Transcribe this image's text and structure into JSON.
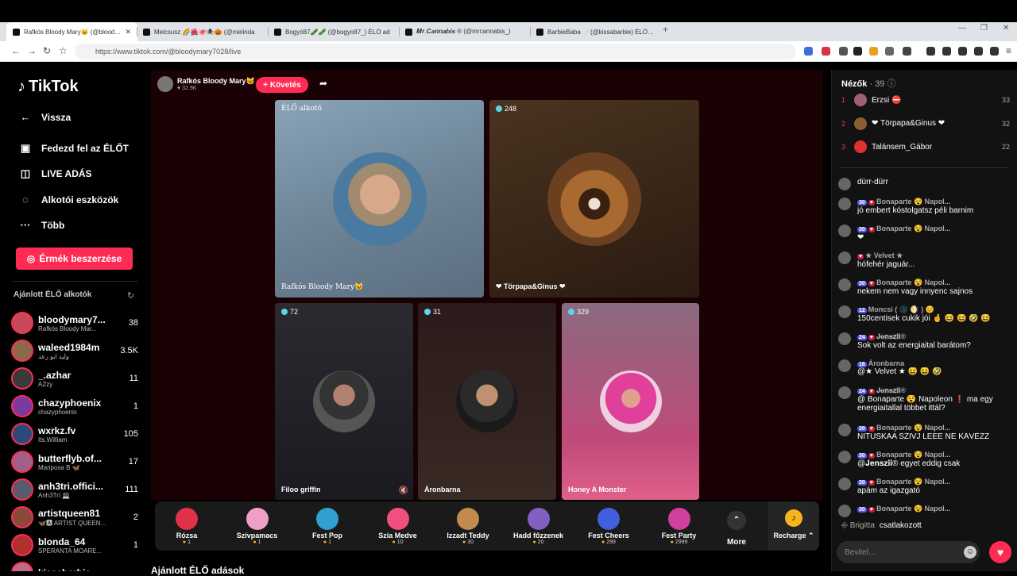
{
  "browser": {
    "tabs": [
      {
        "title": "Rafkós Bloody Mary😺 (@bloodymary7028)"
      },
      {
        "title": "Melcsusz 🌈🌺🐙🕷🎃 (@melinda"
      },
      {
        "title": "Bogyó87🥒🥒 (@bogyo87_) ÉLŐ ad"
      },
      {
        "title": "𝑴𝒓.𝑪𝒂𝒏𝒏𝒂𝒃𝒊𝒔 ® (@mrcannabis_)"
      },
      {
        "title": "BarbieBaba🤍 (@kissabarbie) ÉLŐ ad"
      }
    ],
    "url": "https://www.tiktok.com/@bloodymary7028/live"
  },
  "nav": {
    "logo": "TikTok",
    "back": "Vissza",
    "items": [
      "Fedezd fel az ÉLŐT",
      "LIVE ADÁS",
      "Alkotói eszközök",
      "Több"
    ],
    "coins_button": "Érmék beszerzése",
    "suggested_title": "Ajánlott ÉLŐ alkotók"
  },
  "creators": [
    {
      "name": "bloodymary7...",
      "sub": "Rafkós Bloody Mar...",
      "count": "38",
      "color": "#c84a5a"
    },
    {
      "name": "waleed1984m",
      "sub": "وليد ابو رعد",
      "count": "3.5K",
      "color": "#8a6a4a"
    },
    {
      "name": "_.azhar",
      "sub": "AZzy",
      "count": "11",
      "color": "#3a3a3a"
    },
    {
      "name": "chazyphoenix",
      "sub": "chazyphoenix",
      "count": "1",
      "color": "#7a3aa0"
    },
    {
      "name": "wxrkz.fv",
      "sub": "Its.William",
      "count": "105",
      "color": "#2a4a7a"
    },
    {
      "name": "butterflyb.of...",
      "sub": "Mariposa B 🦋",
      "count": "17",
      "color": "#a0608a"
    },
    {
      "name": "anh3tri.offici...",
      "sub": "Anh3Trí 💻",
      "count": "111",
      "color": "#5a5a6a"
    },
    {
      "name": "artistqueen81",
      "sub": "🦋🅰 ARTIST QUEEN...",
      "count": "2",
      "color": "#8a4a3a"
    },
    {
      "name": "blonda_64",
      "sub": "SPERANTA MOARE...",
      "count": "1",
      "color": "#b03030"
    },
    {
      "name": "kissabarbie",
      "sub": "",
      "count": "",
      "color": "#c06a8a"
    }
  ],
  "live": {
    "host_name": "Rafkós Bloody Mary😺",
    "host_likes": "32.9K",
    "follow_label": "+ Követés",
    "tiles": [
      {
        "tag": "ÉLŐ alkotó",
        "label": "Rafkós Bloody Mary😺",
        "count": ""
      },
      {
        "tag": "",
        "label": "❤ Törpapa&Ginus ❤",
        "count": "248"
      },
      {
        "tag": "",
        "label": "Filoo griffin",
        "count": "72"
      },
      {
        "tag": "",
        "label": "Áronbarna",
        "count": "31"
      },
      {
        "tag": "",
        "label": "Honey A Monster",
        "count": "329"
      }
    ]
  },
  "gifts": [
    {
      "name": "Rózsa",
      "price": "1",
      "color": "#e0304a"
    },
    {
      "name": "Szívpamacs",
      "price": "1",
      "color": "#f0a0c8"
    },
    {
      "name": "Fest Pop",
      "price": "1",
      "color": "#30a0d0"
    },
    {
      "name": "Szia Medve",
      "price": "10",
      "color": "#f05080"
    },
    {
      "name": "Izzadt Teddy",
      "price": "30",
      "color": "#c08a50"
    },
    {
      "name": "Hadd főzzenek",
      "price": "20",
      "color": "#8060c0"
    },
    {
      "name": "Fest Cheers",
      "price": "299",
      "color": "#4060e0"
    },
    {
      "name": "Fest Party",
      "price": "2999",
      "color": "#d040a0"
    }
  ],
  "gift_more": "More",
  "recharge": "Recharge",
  "below_label": "Ajánlott ÉLŐ adások",
  "chat": {
    "viewers_title": "Nézők",
    "viewers_count": "· 39",
    "top_viewers": [
      {
        "rank": "1",
        "name": "Erzsi ⛔",
        "score": "33",
        "color": "#a06070"
      },
      {
        "rank": "2",
        "name": "❤ Törpapa&Ginus ❤",
        "score": "32",
        "color": "#8a6030"
      },
      {
        "rank": "3",
        "name": "Talánsem_Gábor",
        "score": "22",
        "color": "#e03030"
      }
    ],
    "messages": [
      {
        "user": "",
        "text": "dürr-dürr",
        "badge": "",
        "badge2": ""
      },
      {
        "user": "Bonaparte 😵 Napol...",
        "text": "jó embert kóstolgatsz péli barnim",
        "badge": "30",
        "badge2": "♥"
      },
      {
        "user": "Bonaparte 😵 Napol...",
        "text": "❤",
        "badge": "30",
        "badge2": "♥"
      },
      {
        "user": "★ Velvet ★",
        "text": "hófehér jaguár...",
        "badge": "",
        "badge2": "♥"
      },
      {
        "user": "Bonaparte 😵 Napol...",
        "text": "nekem nem vagy innyenc sajnos",
        "badge": "30",
        "badge2": "♥"
      },
      {
        "user": "Moncsi ( 🌑 🌖 ) 😊",
        "text": "150centisek cukik jói 🤞 😆 😆 🤣 😆",
        "badge": "12",
        "badge2": ""
      },
      {
        "user": "𝐉𝐞𝐧𝐬𝐳𝐢𝐢®",
        "text": "Sok volt az energiaital barátom?",
        "badge": "24",
        "badge2": "♥"
      },
      {
        "user": "Áronbarna",
        "text": "@★ Velvet ★ 😆 😆 🤣",
        "badge": "16",
        "badge2": ""
      },
      {
        "user": "𝐉𝐞𝐧𝐬𝐳𝐢𝐢®",
        "text": "@ Bonaparte 😵 Napoleon ❗ ma egy",
        "text2": "energiaitallal többet ittál?",
        "badge": "24",
        "badge2": "♥"
      },
      {
        "user": "Bonaparte 😵 Napol...",
        "text": "NITUSKAA SZIVJ LEEE NE KÁVÉZZ",
        "badge": "30",
        "badge2": "♥"
      },
      {
        "user": "Bonaparte 😵 Napol...",
        "text": "@𝐉𝐞𝐧𝐬𝐳𝐢𝐢® egyet eddig csak",
        "badge": "30",
        "badge2": "♥"
      },
      {
        "user": "Bonaparte 😵 Napol...",
        "text": "apám az igazgató",
        "badge": "30",
        "badge2": "♥"
      },
      {
        "user": "Bonaparte 😵 Napol...",
        "text": "",
        "badge": "30",
        "badge2": "♥"
      }
    ],
    "joined_user": "Brigitta",
    "joined_text": "csatlakozott",
    "input_placeholder": "Bevitel..."
  }
}
